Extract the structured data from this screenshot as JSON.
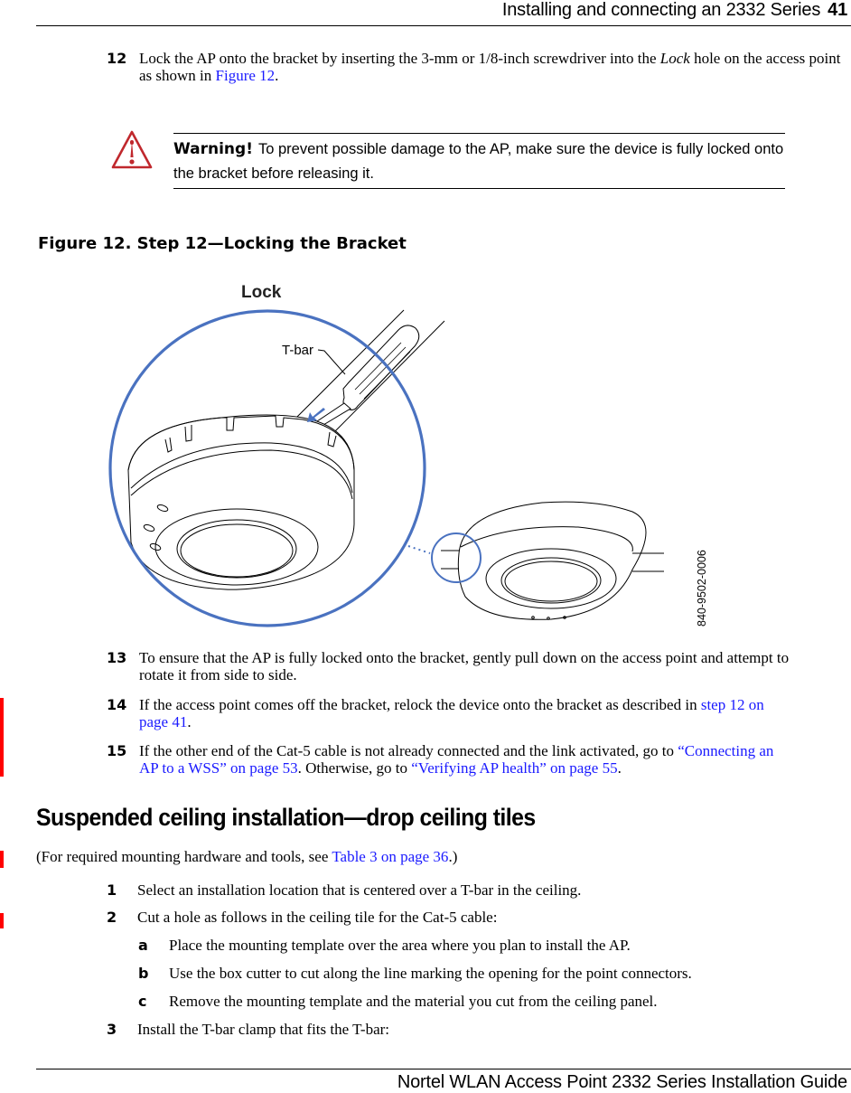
{
  "header": {
    "section_title": "Installing and connecting an 2332 Series",
    "page_number": "41"
  },
  "steps_top": [
    {
      "num": "12",
      "text_parts": [
        {
          "t": "Lock the AP onto the bracket by inserting the 3-mm or 1/8-inch screwdriver into the "
        },
        {
          "t": "Lock",
          "style": "italic"
        },
        {
          "t": " hole on the access point as shown in "
        },
        {
          "t": "Figure 12",
          "style": "link"
        },
        {
          "t": "."
        }
      ]
    }
  ],
  "warning": {
    "icon": "warning-triangle-icon",
    "label": "Warning!",
    "text": "To prevent possible damage to the AP, make sure the device is fully locked onto the bracket before releasing it.",
    "color": "#c0282d"
  },
  "figure": {
    "caption": "Figure 12.  Step 12—Locking the Bracket",
    "label_lock": "Lock",
    "label_tbar": "T-bar",
    "part_number": "840-9502-0006",
    "accent_color": "#4a72c0"
  },
  "steps_after": [
    {
      "num": "13",
      "lines": [
        "To ensure that the AP is fully locked onto the bracket, gently pull down on the access point and attempt to",
        "rotate it from side to side."
      ]
    },
    {
      "num": "14",
      "line1": "If the access point comes off the bracket, relock the device onto the bracket as described in ",
      "link1": "step 12 on",
      "link2": "page 41",
      "end": "."
    },
    {
      "num": "15",
      "line1": "If the other end of the Cat-5 cable is not already connected and the link activated, go to ",
      "link1a": "“Connecting an",
      "link1b": "AP to a WSS” on page 53",
      "mid": ". Otherwise, go to ",
      "link2": "“Verifying AP health” on page 55",
      "end": "."
    }
  ],
  "section": {
    "heading": "Suspended ceiling installation—drop ceiling tiles",
    "intro_before": "(For required mounting hardware and tools, see ",
    "intro_link": "Table 3 on page 36",
    "intro_after": ".)"
  },
  "install_steps": [
    {
      "num": "1",
      "text": "Select an installation location that is centered over a T-bar in the ceiling."
    },
    {
      "num": "2",
      "text": "Cut a hole as follows in the ceiling tile for the Cat-5 cable:",
      "substeps": [
        {
          "letter": "a",
          "text": "Place the mounting template over the area where you plan to install the AP."
        },
        {
          "letter": "b",
          "text": "Use the box cutter to cut along the line marking the opening for the point connectors."
        },
        {
          "letter": "c",
          "text": "Remove the mounting template and the material you cut from the ceiling panel."
        }
      ]
    },
    {
      "num": "3",
      "text": "Install the T-bar clamp that fits the T-bar:"
    }
  ],
  "footer": {
    "text": "Nortel WLAN Access Point 2332 Series Installation Guide"
  }
}
